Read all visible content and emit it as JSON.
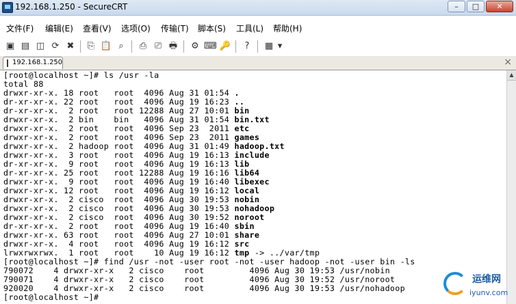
{
  "window": {
    "title": "192.168.1.250 - SecureCRT",
    "buttons": {
      "minimize": "–",
      "maximize": "□",
      "close": "✕"
    }
  },
  "menu": [
    "文件(F)",
    "编辑(E)",
    "查看(V)",
    "选项(O)",
    "传输(T)",
    "脚本(S)",
    "工具(L)",
    "帮助(H)"
  ],
  "toolbar": {
    "icons": [
      "connect-icon",
      "quick-connect-icon",
      "connect-tab-icon",
      "reconnect-icon",
      "disconnect-icon",
      "copy-icon",
      "paste-icon",
      "find-icon",
      "print-icon",
      "print-selection-icon",
      "print-setup-icon",
      "session-options-icon",
      "keymap-icon",
      "key-icon",
      "help-icon",
      "sftp-icon",
      "dropdown-icon"
    ],
    "glyphs": [
      "▣",
      "▤",
      "◫",
      "⟳",
      "✖",
      "⎘",
      "📋",
      "⌕",
      "⎙",
      "⎚",
      "🖶",
      "⚙",
      "⌨",
      "🔑",
      "?",
      "▦",
      "▾"
    ]
  },
  "tab": {
    "label": "192.168.1.250",
    "close": "×"
  },
  "terminal": {
    "lines": [
      {
        "text": "[root@localhost ~]# ls /usr -la",
        "name": ""
      },
      {
        "text": "total 88",
        "name": ""
      },
      {
        "text": "drwxr-xr-x. 18 root   root  4096 Aug 31 01:54 ",
        "name": "."
      },
      {
        "text": "dr-xr-xr-x. 22 root   root  4096 Aug 19 16:23 ",
        "name": ".."
      },
      {
        "text": "dr-xr-xr-x.  2 root   root 12288 Aug 27 10:01 ",
        "name": "bin"
      },
      {
        "text": "drwxr-xr-x.  2 bin    bin   4096 Aug 31 01:54 ",
        "name": "bin.txt"
      },
      {
        "text": "drwxr-xr-x.  2 root   root  4096 Sep 23  2011 ",
        "name": "etc"
      },
      {
        "text": "drwxr-xr-x.  2 root   root  4096 Sep 23  2011 ",
        "name": "games"
      },
      {
        "text": "drwxr-xr-x.  2 hadoop root  4096 Aug 31 01:49 ",
        "name": "hadoop.txt"
      },
      {
        "text": "drwxr-xr-x.  3 root   root  4096 Aug 19 16:13 ",
        "name": "include"
      },
      {
        "text": "dr-xr-xr-x.  9 root   root  4096 Aug 19 16:13 ",
        "name": "lib"
      },
      {
        "text": "dr-xr-xr-x. 25 root   root 12288 Aug 19 16:16 ",
        "name": "lib64"
      },
      {
        "text": "drwxr-xr-x.  9 root   root  4096 Aug 19 16:40 ",
        "name": "libexec"
      },
      {
        "text": "drwxr-xr-x. 12 root   root  4096 Aug 19 16:12 ",
        "name": "local"
      },
      {
        "text": "drwxr-xr-x.  2 cisco  root  4096 Aug 30 19:53 ",
        "name": "nobin"
      },
      {
        "text": "drwxr-xr-x.  2 cisco  root  4096 Aug 30 19:53 ",
        "name": "nohadoop"
      },
      {
        "text": "drwxr-xr-x.  2 cisco  root  4096 Aug 30 19:52 ",
        "name": "noroot"
      },
      {
        "text": "dr-xr-xr-x.  2 root   root  4096 Aug 19 16:40 ",
        "name": "sbin"
      },
      {
        "text": "drwxr-xr-x. 63 root   root  4096 Aug 27 10:01 ",
        "name": "share"
      },
      {
        "text": "drwxr-xr-x.  4 root   root  4096 Aug 19 16:12 ",
        "name": "src"
      },
      {
        "text": "lrwxrwxrwx.  1 root   root    10 Aug 19 16:12 ",
        "name": "tmp",
        "suffix": " -> ../var/tmp"
      },
      {
        "text": "[root@localhost ~]# find /usr -not -user root -not -user hadoop -not -user bin -ls",
        "name": ""
      },
      {
        "text": "790072    4 drwxr-xr-x   2 cisco    root         4096 Aug 30 19:53 /usr/nobin",
        "name": ""
      },
      {
        "text": "790071    4 drwxr-xr-x   2 cisco    root         4096 Aug 30 19:52 /usr/noroot",
        "name": ""
      },
      {
        "text": "920020    4 drwxr-xr-x   2 cisco    root         4096 Aug 30 19:53 /usr/nohadoop",
        "name": ""
      },
      {
        "text": "[root@localhost ~]# ",
        "name": ""
      }
    ]
  },
  "watermark": {
    "cn": "运维网",
    "en": "iyunv.com"
  }
}
